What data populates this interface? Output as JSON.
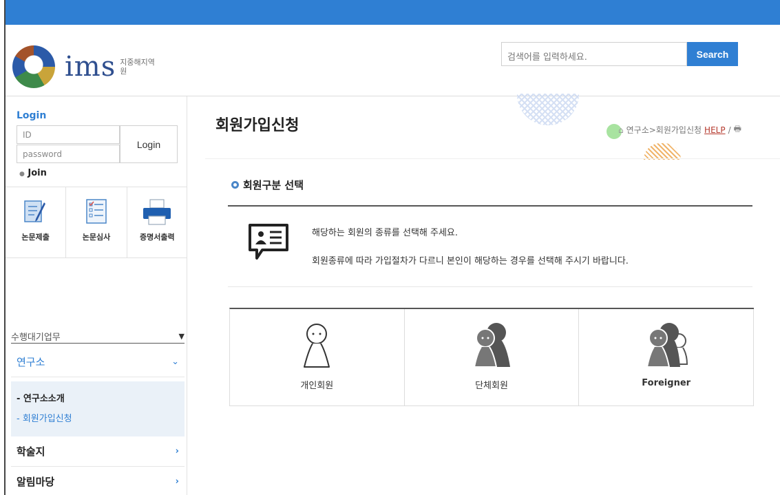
{
  "header": {
    "logo_text": "ims",
    "logo_subtitle": "지중해지역원",
    "search_placeholder": "검색어를 입력하세요.",
    "search_button": "Search"
  },
  "sidebar": {
    "login_title": "Login",
    "id_placeholder": "ID",
    "password_placeholder": "password",
    "login_button": "Login",
    "join_link": "Join",
    "quick_links": [
      {
        "label": "논문제출",
        "icon": "paper-submit-icon"
      },
      {
        "label": "논문심사",
        "icon": "paper-review-icon"
      },
      {
        "label": "증명서출력",
        "icon": "printer-icon"
      }
    ],
    "task_select": "수행대기업무",
    "menu": {
      "lab": "연구소",
      "journal": "학술지",
      "notice": "알림마당"
    },
    "submenu": [
      "- 연구소소개",
      "- 회원가입신청"
    ]
  },
  "main": {
    "page_title": "회원가입신청",
    "breadcrumb": {
      "path": "연구소>회원가입신청",
      "help": "HELP",
      "separator": "/"
    },
    "section_title": "회원구분 선택",
    "notice_line1": "해당하는 회원의 종류를 선택해 주세요.",
    "notice_line2": "회원종류에 따라 가입절차가 다르니 본인이 해당하는 경우를 선택해 주시기 바랍니다.",
    "member_types": [
      {
        "label": "개인회원",
        "icon": "individual-member-icon"
      },
      {
        "label": "단체회원",
        "icon": "group-member-icon"
      },
      {
        "label": "Foreigner",
        "icon": "foreigner-member-icon"
      }
    ]
  },
  "colors": {
    "accent": "#2f7fd3",
    "help": "#b53a2e"
  }
}
